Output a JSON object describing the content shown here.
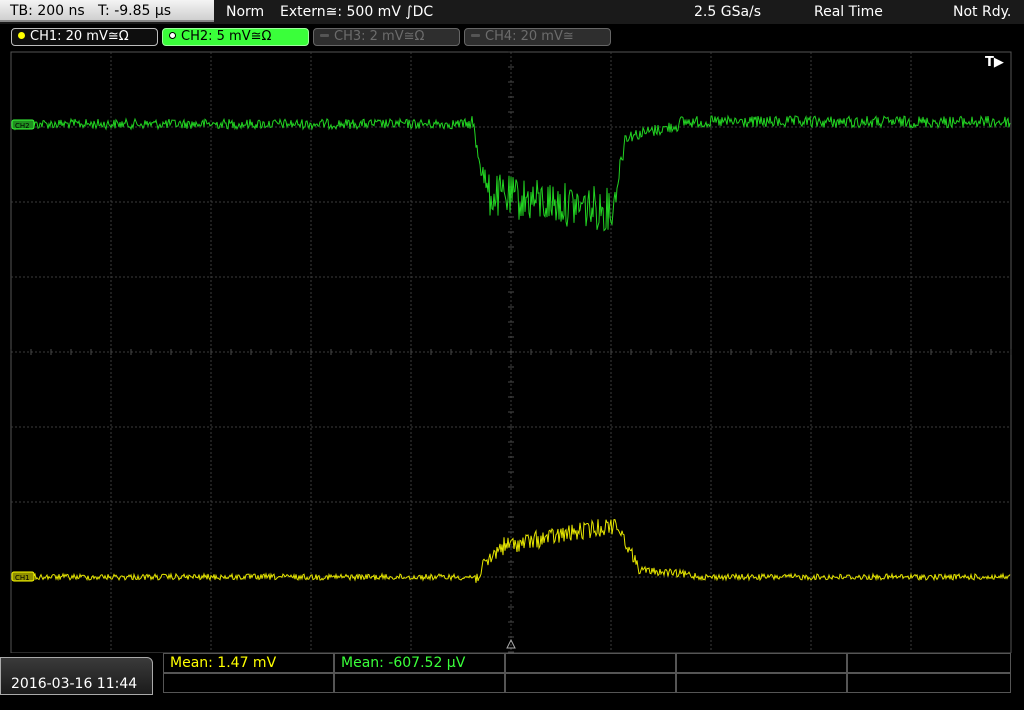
{
  "topbar": {
    "timebase": "TB: 200 ns",
    "trigger_time": "T: -9.85 µs",
    "mode": "Norm",
    "trigger_source": "Extern≅: 500 mV ∫DC",
    "sample_rate": "2.5 GSa/s",
    "acq_mode": "Real Time",
    "status": "Not Rdy."
  },
  "channels": [
    {
      "label": "CH1: 20 mV≅Ω",
      "state": "on",
      "color": "#ffff00"
    },
    {
      "label": "CH2: 5 mV≅Ω",
      "state": "selected",
      "color": "#3aff3a"
    },
    {
      "label": "CH3: 2 mV≅Ω",
      "state": "off",
      "color": "#6c6c6c"
    },
    {
      "label": "CH4: 20 mV≅",
      "state": "off",
      "color": "#6c6c6c"
    }
  ],
  "screen": {
    "trigger_marker": "T▶",
    "ch1_marker": "CH1",
    "ch2_marker": "CH2"
  },
  "measurements": [
    {
      "label": "Mean: 1.47 mV",
      "color": "#ffff00"
    },
    {
      "label": "Mean: -607.52 µV",
      "color": "#3aff3a"
    }
  ],
  "timestamp": "2016-03-16 11:44"
}
